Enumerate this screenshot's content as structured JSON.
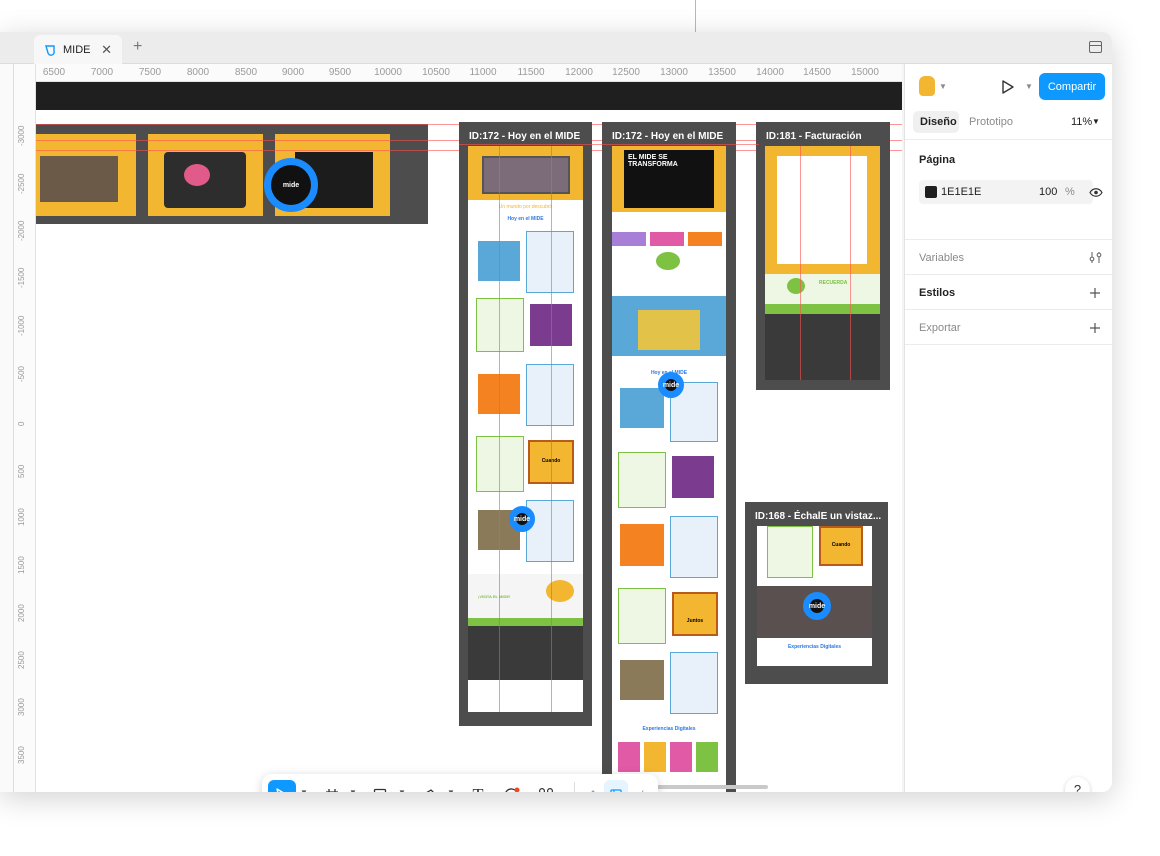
{
  "tab": {
    "title": "MIDE",
    "close": "✕",
    "plus": "+"
  },
  "ruler": {
    "x_ticks": [
      "6500",
      "7000",
      "7500",
      "8000",
      "8500",
      "9000",
      "9500",
      "10000",
      "10500",
      "11000",
      "11500",
      "12000",
      "12500",
      "13000",
      "13500",
      "14000",
      "14500",
      "15000"
    ],
    "y_ticks": [
      "-3000",
      "-2500",
      "-2000",
      "-1500",
      "-1000",
      "-500",
      "0",
      "500",
      "1000",
      "1500",
      "2000",
      "2500",
      "3000",
      "3500",
      "4000"
    ]
  },
  "frames": {
    "f1_label": "ID:172 - Hoy en el MIDE",
    "f2_label": "ID:172 - Hoy en el MIDE",
    "f3_label": "ID:181 - Facturación",
    "f4_label": "ID:168 - ÉchalE un vistaz..."
  },
  "canvas_text": {
    "f1_subtitle": "Un mundo por descubrir",
    "f1_section": "Hoy en el MIDE",
    "f1_visit": "¡VISITA EL MIDE!",
    "f2_hero": "EL MIDE SE TRANSFORMA",
    "f2_section": "Hoy en el MIDE",
    "f2_card_digital": "Experiencias Digitales",
    "f3_recuerda": "RECUERDA",
    "f4_digital": "Experiencias Digitales",
    "card_cuando": "Cuando",
    "card_juntos": "Juntos",
    "avatar_label": "mide"
  },
  "right_panel": {
    "tab_design": "Diseño",
    "tab_prototype": "Prototipo",
    "zoom": "11%",
    "page_heading": "Página",
    "page_color": "1E1E1E",
    "page_opacity": "100",
    "opacity_unit": "%",
    "variables": "Variables",
    "styles": "Estilos",
    "export": "Exportar",
    "share": "Compartir",
    "help": "?"
  },
  "toolbar": {
    "move_icon": "move-tool-icon",
    "frame_icon": "frame-tool-icon",
    "shape_icon": "rectangle-tool-icon",
    "pen_icon": "pen-tool-icon",
    "text_label": "T",
    "comment_icon": "comment-tool-icon",
    "actions_icon": "actions-tool-icon",
    "dev_label": "</>"
  },
  "colors": {
    "accent": "#0d99ff",
    "frame": "#4d4d4d",
    "mide_yellow": "#f2b631",
    "dark": "#1f1f1f"
  }
}
